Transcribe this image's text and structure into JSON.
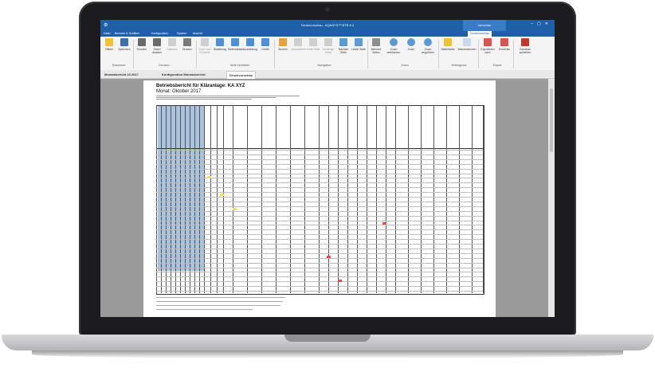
{
  "app": {
    "window_title": "Druckvorschau - AQASYS™ BTB 8.3",
    "context_tab": "Vorschau",
    "ribbon_tabs": [
      "Datei",
      "Berichte & Grafiken",
      "Konfiguration",
      "System",
      "Ansicht",
      "Druckvorschau"
    ],
    "active_ribbon_tab": "Druckvorschau"
  },
  "ribbon": {
    "buttons": [
      {
        "label": "Öffnen",
        "icon": "folder-open-icon"
      },
      {
        "label": "Speichern",
        "icon": "save-icon"
      },
      {
        "label": "Drucken",
        "icon": "print-icon"
      },
      {
        "label": "Sofort drucken",
        "icon": "quick-print-icon"
      },
      {
        "label": "Optionen",
        "icon": "options-icon"
      },
      {
        "label": "Drucker",
        "icon": "printer-icon"
      },
      {
        "label": "Kopf- und Fußzeile",
        "icon": "header-footer-icon"
      },
      {
        "label": "Skalierung",
        "icon": "scale-icon"
      },
      {
        "label": "Seitenränder",
        "icon": "margins-icon"
      },
      {
        "label": "Ausrichtung",
        "icon": "orientation-icon"
      },
      {
        "label": "Größe",
        "icon": "size-icon"
      },
      {
        "label": "Suchen",
        "icon": "search-icon"
      },
      {
        "label": "Lesezeichen",
        "icon": "bookmark-icon"
      },
      {
        "label": "Erste Seite",
        "icon": "first-page-icon"
      },
      {
        "label": "Vorherige Seite",
        "icon": "prev-page-icon"
      },
      {
        "label": "Nächste Seite",
        "icon": "next-page-icon"
      },
      {
        "label": "Letzte Seite",
        "icon": "last-page-icon"
      },
      {
        "label": "Mehrere Seiten",
        "icon": "pointer-icon"
      },
      {
        "label": "Zoom verkleinern",
        "icon": "zoom-out-icon"
      },
      {
        "label": "Zoom",
        "icon": "zoom-icon"
      },
      {
        "label": "Zoom vergrößern",
        "icon": "zoom-in-icon"
      },
      {
        "label": "Seitenfarbe",
        "icon": "page-color-icon"
      },
      {
        "label": "Wasserzeichen",
        "icon": "watermark-icon"
      },
      {
        "label": "Exportieren nach",
        "icon": "export-icon"
      },
      {
        "label": "Email als",
        "icon": "email-icon"
      },
      {
        "label": "Vorschau schließen",
        "icon": "close-preview-icon"
      }
    ],
    "groups": [
      "Dokument",
      "Drucken",
      "Seite einrichten",
      "Navigation",
      "Zoom",
      "Hintergrund",
      "Export"
    ]
  },
  "document_tabs": [
    "Monatsbericht 10.2017",
    "Konfiguration Monatsbericht",
    "Druckvorschau"
  ],
  "page": {
    "title": "Betriebsbericht für Kläranlage: KA XYZ",
    "subtitle": "Monat: Oktober 2017"
  },
  "colors": {
    "title_bar": "#1e5fa8",
    "highlight_columns": "#a9c3df",
    "mark_yellow": "#f4e24a",
    "mark_red": "#e05050"
  }
}
